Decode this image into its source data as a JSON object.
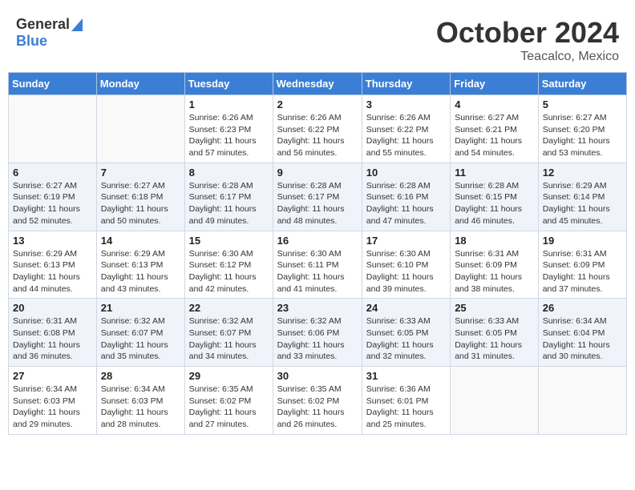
{
  "header": {
    "logo_line1": "General",
    "logo_line2": "Blue",
    "month": "October 2024",
    "location": "Teacalco, Mexico"
  },
  "days_of_week": [
    "Sunday",
    "Monday",
    "Tuesday",
    "Wednesday",
    "Thursday",
    "Friday",
    "Saturday"
  ],
  "weeks": [
    [
      {
        "day": "",
        "info": ""
      },
      {
        "day": "",
        "info": ""
      },
      {
        "day": "1",
        "info": "Sunrise: 6:26 AM\nSunset: 6:23 PM\nDaylight: 11 hours and 57 minutes."
      },
      {
        "day": "2",
        "info": "Sunrise: 6:26 AM\nSunset: 6:22 PM\nDaylight: 11 hours and 56 minutes."
      },
      {
        "day": "3",
        "info": "Sunrise: 6:26 AM\nSunset: 6:22 PM\nDaylight: 11 hours and 55 minutes."
      },
      {
        "day": "4",
        "info": "Sunrise: 6:27 AM\nSunset: 6:21 PM\nDaylight: 11 hours and 54 minutes."
      },
      {
        "day": "5",
        "info": "Sunrise: 6:27 AM\nSunset: 6:20 PM\nDaylight: 11 hours and 53 minutes."
      }
    ],
    [
      {
        "day": "6",
        "info": "Sunrise: 6:27 AM\nSunset: 6:19 PM\nDaylight: 11 hours and 52 minutes."
      },
      {
        "day": "7",
        "info": "Sunrise: 6:27 AM\nSunset: 6:18 PM\nDaylight: 11 hours and 50 minutes."
      },
      {
        "day": "8",
        "info": "Sunrise: 6:28 AM\nSunset: 6:17 PM\nDaylight: 11 hours and 49 minutes."
      },
      {
        "day": "9",
        "info": "Sunrise: 6:28 AM\nSunset: 6:17 PM\nDaylight: 11 hours and 48 minutes."
      },
      {
        "day": "10",
        "info": "Sunrise: 6:28 AM\nSunset: 6:16 PM\nDaylight: 11 hours and 47 minutes."
      },
      {
        "day": "11",
        "info": "Sunrise: 6:28 AM\nSunset: 6:15 PM\nDaylight: 11 hours and 46 minutes."
      },
      {
        "day": "12",
        "info": "Sunrise: 6:29 AM\nSunset: 6:14 PM\nDaylight: 11 hours and 45 minutes."
      }
    ],
    [
      {
        "day": "13",
        "info": "Sunrise: 6:29 AM\nSunset: 6:13 PM\nDaylight: 11 hours and 44 minutes."
      },
      {
        "day": "14",
        "info": "Sunrise: 6:29 AM\nSunset: 6:13 PM\nDaylight: 11 hours and 43 minutes."
      },
      {
        "day": "15",
        "info": "Sunrise: 6:30 AM\nSunset: 6:12 PM\nDaylight: 11 hours and 42 minutes."
      },
      {
        "day": "16",
        "info": "Sunrise: 6:30 AM\nSunset: 6:11 PM\nDaylight: 11 hours and 41 minutes."
      },
      {
        "day": "17",
        "info": "Sunrise: 6:30 AM\nSunset: 6:10 PM\nDaylight: 11 hours and 39 minutes."
      },
      {
        "day": "18",
        "info": "Sunrise: 6:31 AM\nSunset: 6:09 PM\nDaylight: 11 hours and 38 minutes."
      },
      {
        "day": "19",
        "info": "Sunrise: 6:31 AM\nSunset: 6:09 PM\nDaylight: 11 hours and 37 minutes."
      }
    ],
    [
      {
        "day": "20",
        "info": "Sunrise: 6:31 AM\nSunset: 6:08 PM\nDaylight: 11 hours and 36 minutes."
      },
      {
        "day": "21",
        "info": "Sunrise: 6:32 AM\nSunset: 6:07 PM\nDaylight: 11 hours and 35 minutes."
      },
      {
        "day": "22",
        "info": "Sunrise: 6:32 AM\nSunset: 6:07 PM\nDaylight: 11 hours and 34 minutes."
      },
      {
        "day": "23",
        "info": "Sunrise: 6:32 AM\nSunset: 6:06 PM\nDaylight: 11 hours and 33 minutes."
      },
      {
        "day": "24",
        "info": "Sunrise: 6:33 AM\nSunset: 6:05 PM\nDaylight: 11 hours and 32 minutes."
      },
      {
        "day": "25",
        "info": "Sunrise: 6:33 AM\nSunset: 6:05 PM\nDaylight: 11 hours and 31 minutes."
      },
      {
        "day": "26",
        "info": "Sunrise: 6:34 AM\nSunset: 6:04 PM\nDaylight: 11 hours and 30 minutes."
      }
    ],
    [
      {
        "day": "27",
        "info": "Sunrise: 6:34 AM\nSunset: 6:03 PM\nDaylight: 11 hours and 29 minutes."
      },
      {
        "day": "28",
        "info": "Sunrise: 6:34 AM\nSunset: 6:03 PM\nDaylight: 11 hours and 28 minutes."
      },
      {
        "day": "29",
        "info": "Sunrise: 6:35 AM\nSunset: 6:02 PM\nDaylight: 11 hours and 27 minutes."
      },
      {
        "day": "30",
        "info": "Sunrise: 6:35 AM\nSunset: 6:02 PM\nDaylight: 11 hours and 26 minutes."
      },
      {
        "day": "31",
        "info": "Sunrise: 6:36 AM\nSunset: 6:01 PM\nDaylight: 11 hours and 25 minutes."
      },
      {
        "day": "",
        "info": ""
      },
      {
        "day": "",
        "info": ""
      }
    ]
  ]
}
